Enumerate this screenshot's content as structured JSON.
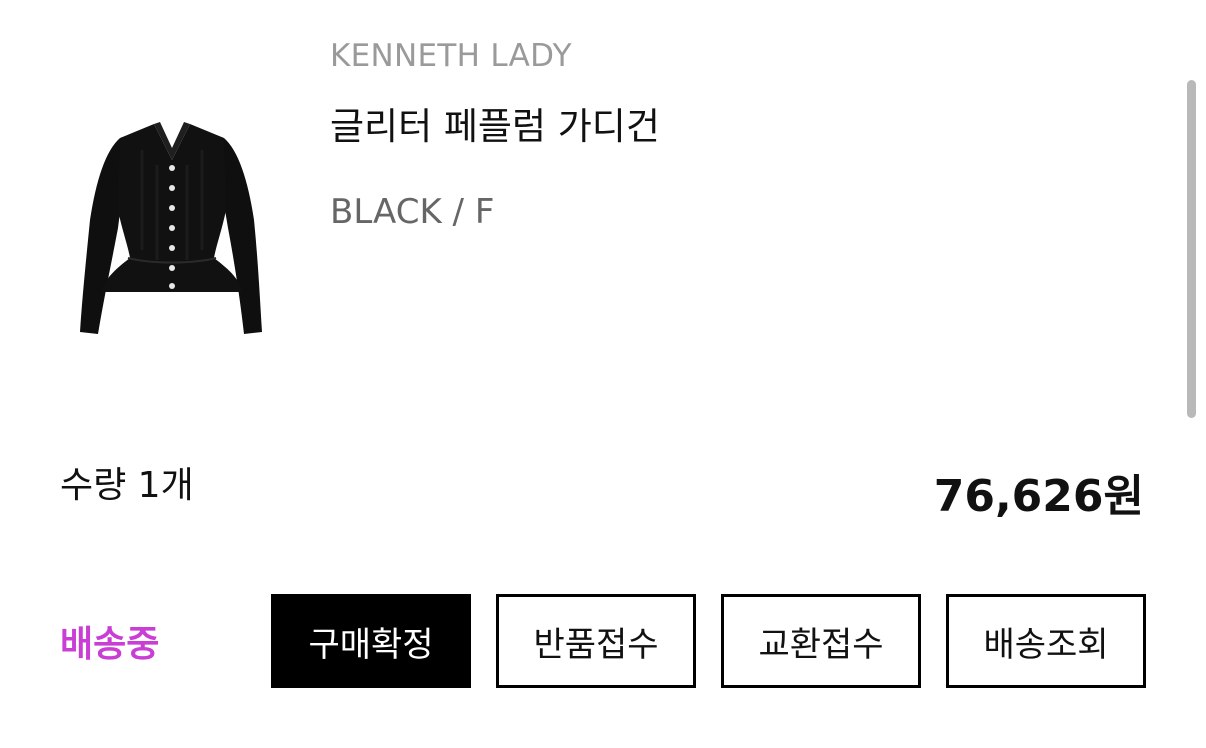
{
  "product": {
    "brand": "KENNETH LADY",
    "name": "글리터 페플럼 가디건",
    "option": "BLACK / F",
    "image_icon": "black-cardigan-image"
  },
  "order": {
    "quantity_text": "수량 1개",
    "price_text": "76,626원",
    "status_text": "배송중",
    "status_color": "#c93fd6"
  },
  "actions": {
    "confirm_label": "구매확정",
    "return_label": "반품접수",
    "exchange_label": "교환접수",
    "tracking_label": "배송조회"
  }
}
